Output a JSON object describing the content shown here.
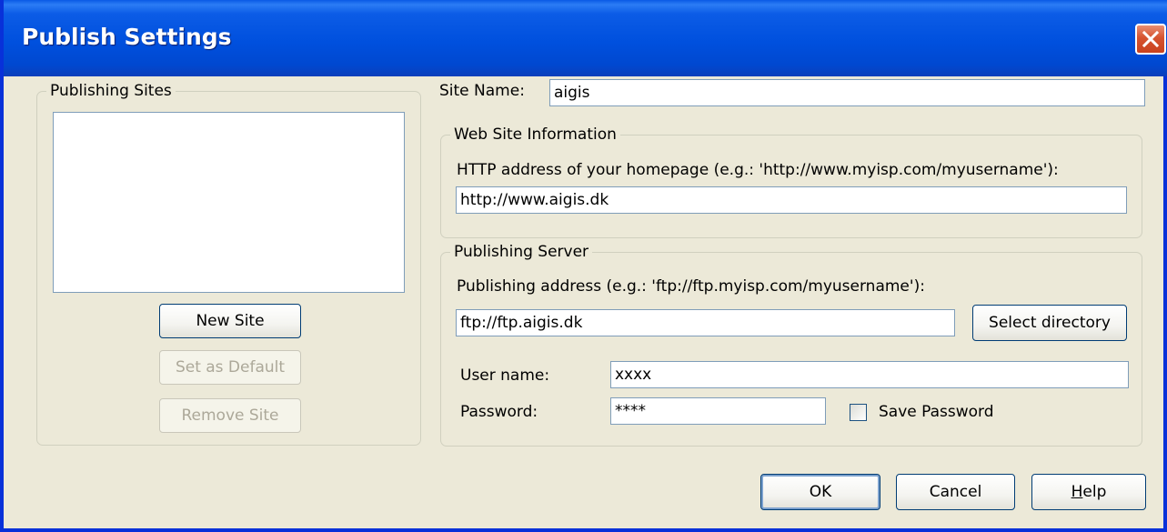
{
  "window": {
    "title": "Publish Settings"
  },
  "sites": {
    "group_label": "Publishing Sites",
    "items": [],
    "new_site": "New Site",
    "set_default": "Set as Default",
    "remove_site": "Remove Site"
  },
  "site_name": {
    "label": "Site Name:",
    "value": "aigis"
  },
  "web_info": {
    "group_label": "Web Site Information",
    "http_label": "HTTP address of your homepage (e.g.: 'http://www.myisp.com/myusername'):",
    "http_value": "http://www.aigis.dk"
  },
  "server": {
    "group_label": "Publishing Server",
    "addr_label": "Publishing address (e.g.: 'ftp://ftp.myisp.com/myusername'):",
    "addr_value": "ftp://ftp.aigis.dk",
    "select_dir": "Select directory",
    "user_label": "User name:",
    "user_value": "xxxx",
    "pass_label": "Password:",
    "pass_value": "****",
    "save_pass_label": "Save Password",
    "save_pass_checked": false
  },
  "footer": {
    "ok": "OK",
    "cancel": "Cancel",
    "help_prefix": "",
    "help_underlined": "H",
    "help_rest": "elp"
  }
}
